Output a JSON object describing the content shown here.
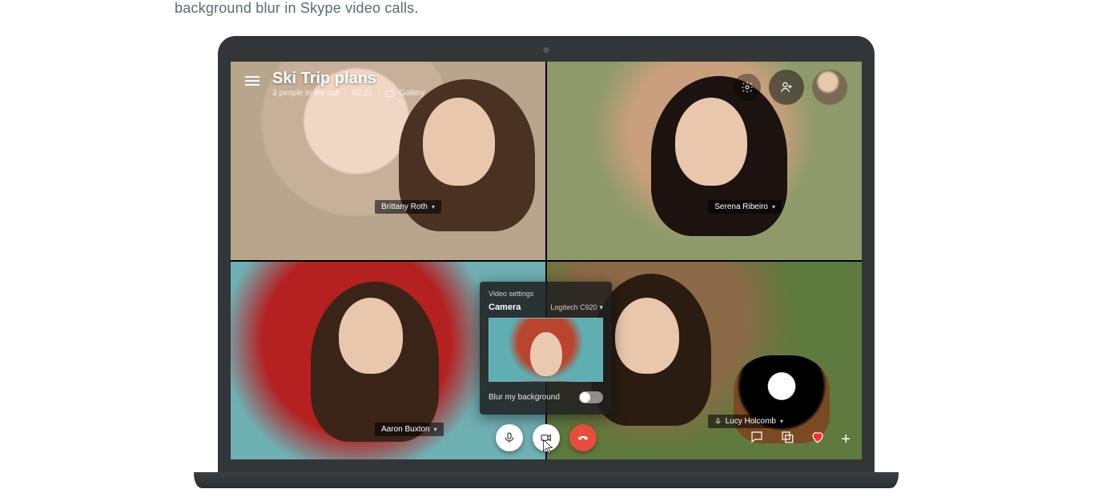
{
  "article": {
    "text_fragment": "background blur in Skype video calls."
  },
  "call": {
    "title": "Ski Trip plans",
    "people_status": "3 people in the call",
    "duration": "02:21",
    "view_mode": "Gallery"
  },
  "participants": {
    "top_left": {
      "name": "Brittany Roth"
    },
    "top_right": {
      "name": "Serena Ribeiro"
    },
    "bottom_left": {
      "name": "Aaron Buxton"
    },
    "bottom_right": {
      "name": "Lucy Holcomb"
    }
  },
  "popover": {
    "header": "Video settings",
    "camera_label": "Camera",
    "camera_value": "Logitech C920",
    "blur_label": "Blur my background",
    "blur_enabled": false
  },
  "icons": {
    "hamburger": "menu-icon",
    "settings": "settings-icon",
    "add_user": "add-user-icon",
    "mic": "microphone-icon",
    "video": "video-icon",
    "hangup": "hangup-icon",
    "chat": "chat-icon",
    "share": "screenshare-icon",
    "heart": "heart-icon",
    "plus": "plus-icon"
  }
}
